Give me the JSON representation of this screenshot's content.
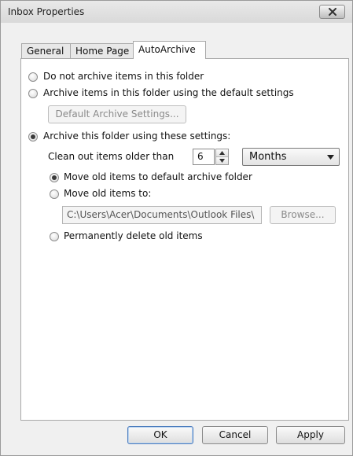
{
  "window": {
    "title": "Inbox Properties"
  },
  "tabs": [
    {
      "label": "General",
      "active": false
    },
    {
      "label": "Home Page",
      "active": false
    },
    {
      "label": "AutoArchive",
      "active": true
    }
  ],
  "options": {
    "do_not_archive": {
      "label": "Do not archive items in this folder",
      "checked": false
    },
    "archive_default": {
      "label": "Archive items in this folder using the default settings",
      "checked": false
    },
    "default_settings_button": "Default Archive Settings...",
    "archive_custom": {
      "label": "Archive this folder using these settings:",
      "checked": true
    }
  },
  "settings": {
    "clean_out_label": "Clean out items older than",
    "age_value": "6",
    "age_unit": "Months",
    "move_default": {
      "label": "Move old items to default archive folder",
      "checked": true
    },
    "move_to": {
      "label": "Move old items to:",
      "checked": false
    },
    "path_value": "C:\\Users\\Acer\\Documents\\Outlook Files\\",
    "browse_button": "Browse...",
    "permanently_delete": {
      "label": "Permanently delete old items",
      "checked": false
    }
  },
  "footer": {
    "ok": "OK",
    "cancel": "Cancel",
    "apply": "Apply"
  }
}
